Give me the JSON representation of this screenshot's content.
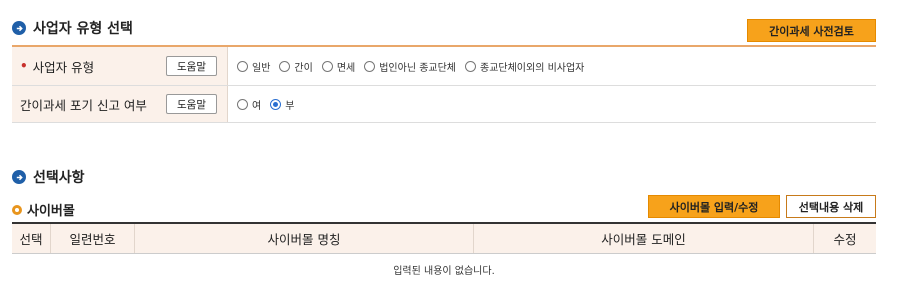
{
  "section1": {
    "title": "사업자 유형 선택",
    "precheck_button": "간이과세 사전검토",
    "rows": [
      {
        "label": "사업자 유형",
        "required": true,
        "help": "도움말",
        "options": [
          "일반",
          "간이",
          "면세",
          "법인아닌 종교단체",
          "종교단체이외의 비사업자"
        ],
        "selected": null
      },
      {
        "label": "간이과세 포기 신고 여부",
        "required": false,
        "help": "도움말",
        "options": [
          "여",
          "부"
        ],
        "selected": "부"
      }
    ]
  },
  "section2": {
    "title": "선택사항",
    "subsection": "사이버몰",
    "input_button": "사이버몰 입력/수정",
    "delete_button": "선택내용 삭제",
    "columns": [
      "선택",
      "일련번호",
      "사이버몰 명칭",
      "사이버몰 도메인",
      "수정"
    ],
    "empty_message": "입력된 내용이 없습니다."
  }
}
